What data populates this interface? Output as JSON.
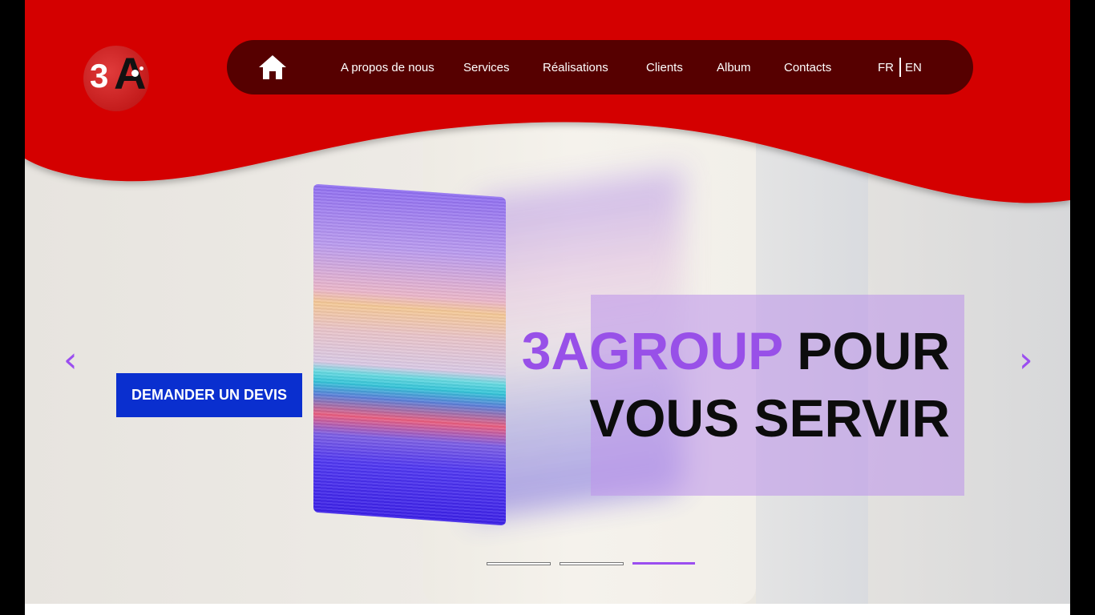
{
  "brand": {
    "name": "3A Group",
    "logo_text": "3",
    "logo_letter": "A",
    "accent_color": "#9850e8",
    "header_color": "#d40000",
    "nav_bg": "#560000"
  },
  "nav": {
    "home_icon": "home-icon",
    "items": [
      "A propos de nous",
      "Services",
      "Réalisations",
      "Clients",
      "Album",
      "Contacts"
    ],
    "lang": {
      "fr": "FR",
      "en": "EN"
    }
  },
  "hero": {
    "cta_label": "DEMANDER UN DEVIS",
    "headline_accent": "3AGROUP",
    "headline_rest_1": " POUR",
    "headline_line_2": "VOUS SERVIR",
    "prev_icon": "chevron-left-icon",
    "next_icon": "chevron-right-icon",
    "prev_glyph": "‹",
    "next_glyph": "›",
    "slides_count": 3,
    "active_slide": 3
  }
}
